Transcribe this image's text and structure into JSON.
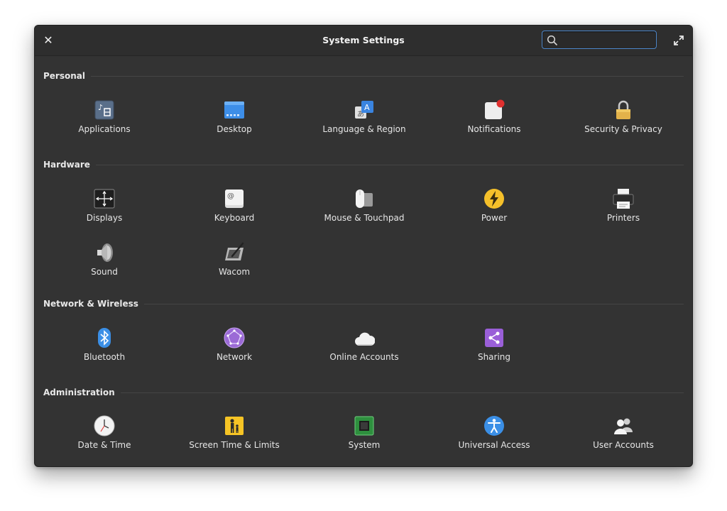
{
  "window": {
    "title": "System Settings",
    "search": {
      "placeholder": "",
      "value": ""
    },
    "close_icon": "close-icon",
    "maximize_icon": "maximize-icon"
  },
  "sections": {
    "personal": {
      "title": "Personal",
      "items": [
        {
          "label": "Applications",
          "icon": "applications-icon"
        },
        {
          "label": "Desktop",
          "icon": "desktop-icon"
        },
        {
          "label": "Language & Region",
          "icon": "language-icon"
        },
        {
          "label": "Notifications",
          "icon": "notifications-icon"
        },
        {
          "label": "Security & Privacy",
          "icon": "lock-icon"
        }
      ]
    },
    "hardware": {
      "title": "Hardware",
      "items": [
        {
          "label": "Displays",
          "icon": "displays-icon"
        },
        {
          "label": "Keyboard",
          "icon": "keyboard-icon"
        },
        {
          "label": "Mouse & Touchpad",
          "icon": "mouse-icon"
        },
        {
          "label": "Power",
          "icon": "power-icon"
        },
        {
          "label": "Printers",
          "icon": "printer-icon"
        },
        {
          "label": "Sound",
          "icon": "speaker-icon"
        },
        {
          "label": "Wacom",
          "icon": "tablet-icon"
        }
      ]
    },
    "network": {
      "title": "Network & Wireless",
      "items": [
        {
          "label": "Bluetooth",
          "icon": "bluetooth-icon"
        },
        {
          "label": "Network",
          "icon": "network-icon"
        },
        {
          "label": "Online Accounts",
          "icon": "cloud-icon"
        },
        {
          "label": "Sharing",
          "icon": "share-icon"
        }
      ]
    },
    "administration": {
      "title": "Administration",
      "items": [
        {
          "label": "Date & Time",
          "icon": "clock-icon"
        },
        {
          "label": "Screen Time & Limits",
          "icon": "screen-time-icon"
        },
        {
          "label": "System",
          "icon": "chip-icon"
        },
        {
          "label": "Universal Access",
          "icon": "accessibility-icon"
        },
        {
          "label": "User Accounts",
          "icon": "users-icon"
        }
      ]
    }
  }
}
